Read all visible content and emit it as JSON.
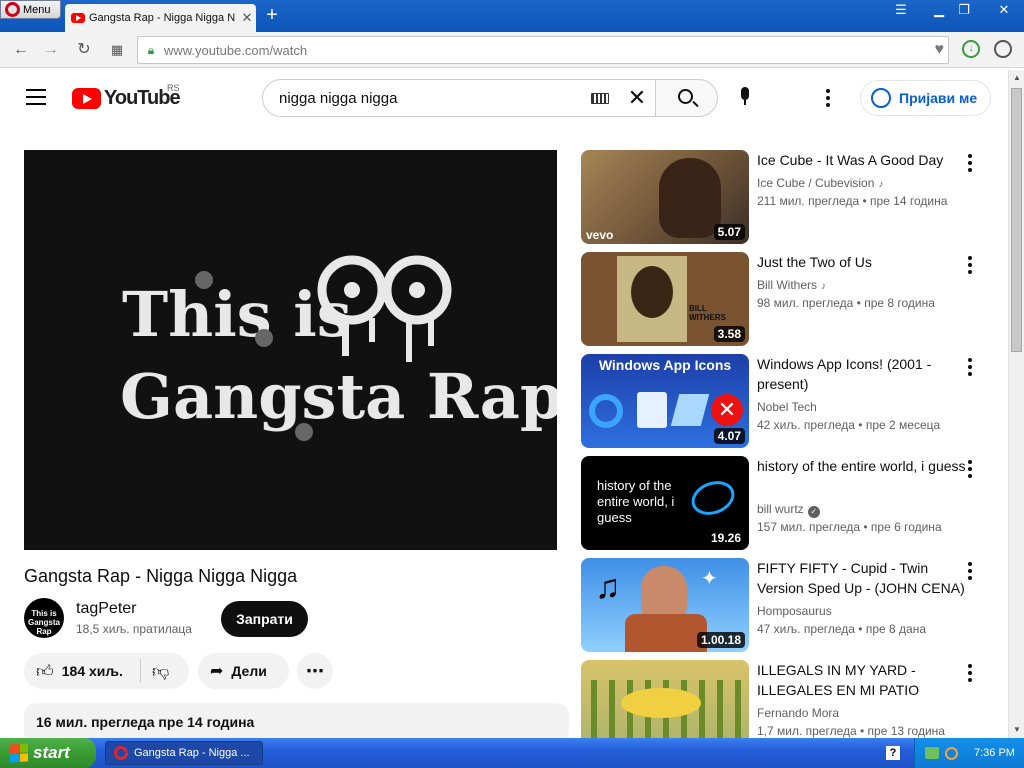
{
  "browser": {
    "menu_label": "Menu",
    "tab_title": "Gangsta Rap - Nigga Nigga N",
    "new_tab": "+",
    "url_host": "www.youtube.com",
    "url_path": "/watch"
  },
  "header": {
    "logo_text": "YouTube",
    "region": "RS",
    "search_value": "nigga nigga nigga",
    "signin_label": "Пријави ме"
  },
  "player": {
    "line1": "This is",
    "line2": "Gangsta Rap"
  },
  "video": {
    "title": "Gangsta Rap - Nigga Nigga Nigga",
    "channel": "tagPeter",
    "subscribers": "18,5 хиљ. пратилаца",
    "avatar_text": "This is Gangsta Rap",
    "subscribe_label": "Запрати",
    "likes": "184 хиљ.",
    "share_label": "Дели",
    "views_date": "16 мил. прегледа  пре 14 година"
  },
  "related": [
    {
      "title": "Ice Cube - It Was A Good Day",
      "channel": "Ice Cube / Cubevision",
      "meta": "211 мил. прегледа  • пре 14 година",
      "duration": "5.07",
      "thumb_text": "vevo"
    },
    {
      "title": "Just the Two of Us",
      "channel": "Bill Withers",
      "meta": "98 мил. прегледа  • пре 8 година",
      "duration": "3.58",
      "thumb_text": "BILL WITHERS"
    },
    {
      "title": "Windows App Icons! (2001 - present)",
      "channel": "Nobel Tech",
      "meta": "42 хиљ. прегледа  • пре 2 месеца",
      "duration": "4.07",
      "thumb_text": "Windows App Icons"
    },
    {
      "title": "history of the entire world, i guess",
      "channel": "bill wurtz",
      "meta": "157 мил. прегледа  • пре 6 година",
      "duration": "19.26",
      "thumb_text": "history of the entire world, i guess"
    },
    {
      "title": "FIFTY FIFTY - Cupid - Twin Version Sped Up - (JOHN CENA)",
      "channel": "Homposaurus",
      "meta": "47 хиљ. прегледа  • пре 8 дана",
      "duration": "1.00.18",
      "thumb_text": ""
    },
    {
      "title": "ILLEGALS IN MY YARD - ILLEGALES EN MI PATIO",
      "channel": "Fernando Mora",
      "meta": "1,7 мил. прегледа  • пре 13 година",
      "duration": "",
      "thumb_text": ""
    }
  ],
  "taskbar": {
    "start_label": "start",
    "task_title": "Gangsta Rap - Nigga ...",
    "help": "?",
    "clock": "7:36 PM"
  },
  "colors": {
    "accent": "#065fd4",
    "youtube_red": "#ff0000",
    "taskbar": "#245edb"
  }
}
